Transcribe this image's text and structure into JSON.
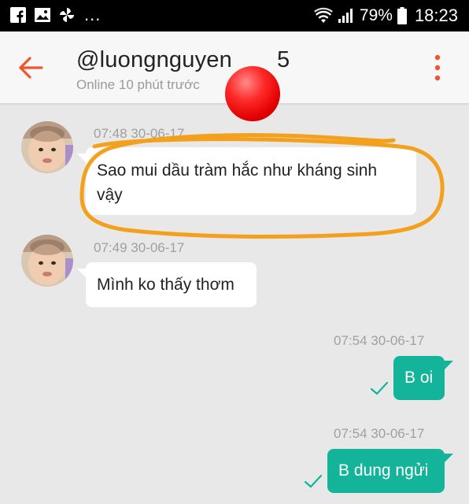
{
  "status_bar": {
    "notification_icons": [
      "facebook-icon",
      "gallery-icon",
      "pinwheel-icon"
    ],
    "more": "...",
    "battery": "79%",
    "time": "18:23"
  },
  "header": {
    "title": "@luongnguyen",
    "title_suffix": "5",
    "subtitle": "Online 10 phút trước"
  },
  "messages": [
    {
      "direction": "incoming",
      "timestamp": "07:48 30-06-17",
      "lines": [
        "Sao mui dầu tràm hắc như kháng sinh",
        "vậy"
      ]
    },
    {
      "direction": "incoming",
      "timestamp": "07:49 30-06-17",
      "lines": [
        "Mình ko thấy thơm"
      ]
    },
    {
      "direction": "outgoing",
      "timestamp": "07:54 30-06-17",
      "lines": [
        "B oi"
      ]
    },
    {
      "direction": "outgoing",
      "timestamp": "07:54 30-06-17",
      "lines": [
        "B dung ngửi"
      ]
    }
  ],
  "colors": {
    "accent": "#f0562a",
    "outgoing_bubble": "#14b49a",
    "highlight_stroke": "#f39c12"
  }
}
